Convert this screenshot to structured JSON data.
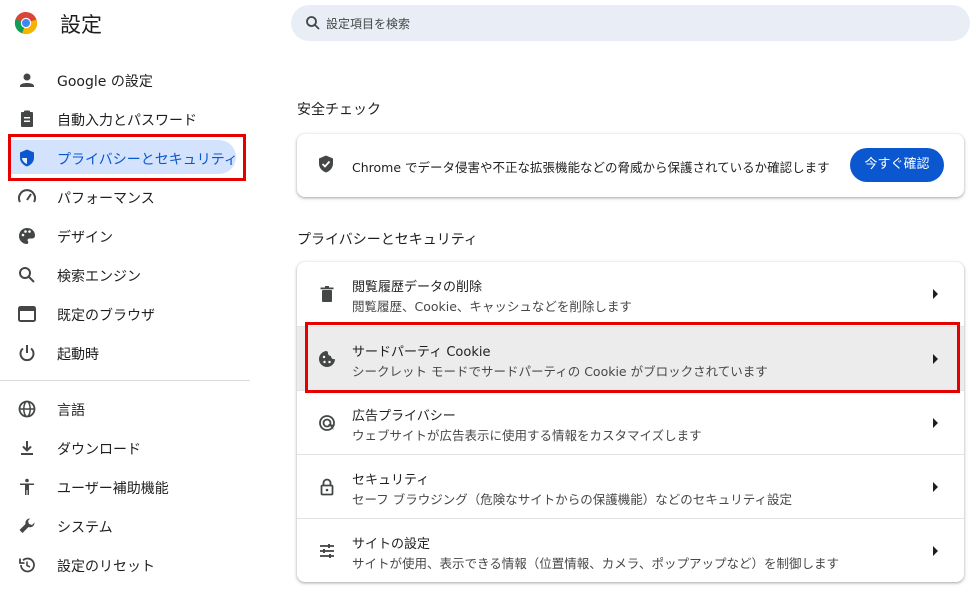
{
  "header": {
    "title": "設定",
    "search_placeholder": "設定項目を検索"
  },
  "sidebar": {
    "items": [
      {
        "label": "Google の設定",
        "icon": "person-icon"
      },
      {
        "label": "自動入力とパスワード",
        "icon": "clipboard-icon"
      },
      {
        "label": "プライバシーとセキュリティ",
        "icon": "shield-icon",
        "active": true
      },
      {
        "label": "パフォーマンス",
        "icon": "speedometer-icon"
      },
      {
        "label": "デザイン",
        "icon": "palette-icon"
      },
      {
        "label": "検索エンジン",
        "icon": "search-icon"
      },
      {
        "label": "既定のブラウザ",
        "icon": "browser-icon"
      },
      {
        "label": "起動時",
        "icon": "power-icon"
      },
      {
        "label": "言語",
        "icon": "globe-icon"
      },
      {
        "label": "ダウンロード",
        "icon": "download-icon"
      },
      {
        "label": "ユーザー補助機能",
        "icon": "accessibility-icon"
      },
      {
        "label": "システム",
        "icon": "wrench-icon"
      },
      {
        "label": "設定のリセット",
        "icon": "history-icon"
      }
    ]
  },
  "safety_check": {
    "section_title": "安全チェック",
    "text": "Chrome でデータ侵害や不正な拡張機能などの脅威から保護されているか確認します",
    "button": "今すぐ確認"
  },
  "privacy": {
    "section_title": "プライバシーとセキュリティ",
    "rows": [
      {
        "title": "閲覧履歴データの削除",
        "subtitle": "閲覧履歴、Cookie、キャッシュなどを削除します",
        "icon": "trash-icon"
      },
      {
        "title": "サードパーティ Cookie",
        "subtitle": "シークレット モードでサードパーティの Cookie がブロックされています",
        "icon": "cookie-icon"
      },
      {
        "title": "広告プライバシー",
        "subtitle": "ウェブサイトが広告表示に使用する情報をカスタマイズします",
        "icon": "ads-icon"
      },
      {
        "title": "セキュリティ",
        "subtitle": "セーフ ブラウジング（危険なサイトからの保護機能）などのセキュリティ設定",
        "icon": "lock-icon"
      },
      {
        "title": "サイトの設定",
        "subtitle": "サイトが使用、表示できる情報（位置情報、カメラ、ポップアップなど）を制御します",
        "icon": "tune-icon"
      }
    ]
  },
  "colors": {
    "accent": "#0b57d0",
    "active_bg": "#d3e3fd",
    "highlight_border": "#e60000"
  }
}
